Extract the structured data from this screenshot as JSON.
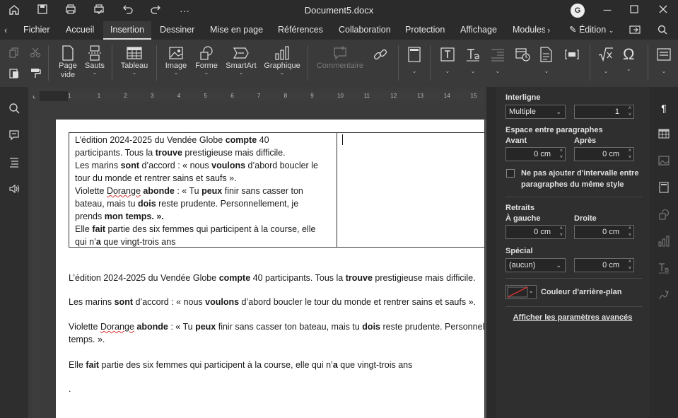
{
  "window": {
    "title": "Document5.docx",
    "user_initial": "G"
  },
  "tabs": [
    {
      "label": "Fichier"
    },
    {
      "label": "Accueil"
    },
    {
      "label": "Insertion"
    },
    {
      "label": "Dessiner"
    },
    {
      "label": "Mise en page"
    },
    {
      "label": "Références"
    },
    {
      "label": "Collaboration"
    },
    {
      "label": "Protection"
    },
    {
      "label": "Affichage"
    },
    {
      "label": "Modules"
    }
  ],
  "edit_mode": "Édition",
  "toolbar": {
    "page_vide": [
      "Page",
      "vide"
    ],
    "sauts": "Sauts",
    "tableau": "Tableau",
    "image": "Image",
    "forme": "Forme",
    "smartart": "SmartArt",
    "graphique": "Graphique",
    "commentaire": "Commentaire"
  },
  "ruler_numbers": [
    "1",
    "1",
    "2",
    "3",
    "4",
    "5",
    "6",
    "7",
    "8",
    "9",
    "10",
    "11",
    "12",
    "13",
    "14",
    "15"
  ],
  "document": {
    "table_lines": [
      [
        "L’édition 2024-2025 du Vendée Globe ",
        "compte",
        " 40"
      ],
      [
        "participants. Tous la ",
        "trouve",
        " prestigieuse mais difficile."
      ],
      [
        "Les marins ",
        "sont",
        " d’accord : « nous ",
        "voulons",
        " d’abord boucler le"
      ],
      [
        "tour du monde et rentrer sains et saufs »."
      ],
      [
        "Violette ",
        "Dorange",
        " ",
        "abonde",
        " : « Tu ",
        "peux",
        " finir sans casser ton"
      ],
      [
        "bateau, mais tu ",
        "dois",
        " reste prudente. Personnellement, je"
      ],
      [
        "prends",
        " mon temps. »."
      ],
      [
        "Elle ",
        "fait",
        " partie des six femmes qui participent à la course, elle"
      ],
      [
        "qui n’",
        "a",
        " que vingt-trois ans"
      ]
    ],
    "p1": [
      "L’édition 2024-2025 du Vendée Globe ",
      "compte",
      " 40 participants. Tous la ",
      "trouve",
      " prestigieuse mais difficile."
    ],
    "p2": [
      "Les marins ",
      "sont",
      " d’accord : « nous ",
      "voulons",
      " d’abord boucler le tour du monde et rentrer sains et saufs »."
    ],
    "p3a": [
      "Violette ",
      "Dorange",
      " ",
      "abonde",
      " : « Tu ",
      "peux",
      " finir sans casser ton bateau, mais tu ",
      "dois",
      " reste prudente. Personnellement, je"
    ],
    "p3b": "temps. ».",
    "p4": [
      "Elle ",
      "fait",
      " partie des six femmes qui participent à la course, elle qui n’",
      "a",
      " que vingt-trois ans"
    ],
    "p5": "."
  },
  "panel": {
    "interligne_label": "Interligne",
    "interligne_mode": "Multiple",
    "interligne_value": "1",
    "espace_label": "Espace entre paragraphes",
    "avant_label": "Avant",
    "apres_label": "Après",
    "avant_value": "0 cm",
    "apres_value": "0 cm",
    "no_interval_text": "Ne pas ajouter d'intervalle entre paragraphes du même style",
    "retraits_label": "Retraits",
    "gauche_label": "À gauche",
    "droite_label": "Droite",
    "gauche_value": "0 cm",
    "droite_value": "0 cm",
    "special_label": "Spécial",
    "special_mode": "(aucun)",
    "special_value": "0 cm",
    "bg_color_label": "Couleur d'arrière-plan",
    "advanced_link": "Afficher les paramètres avancés"
  }
}
